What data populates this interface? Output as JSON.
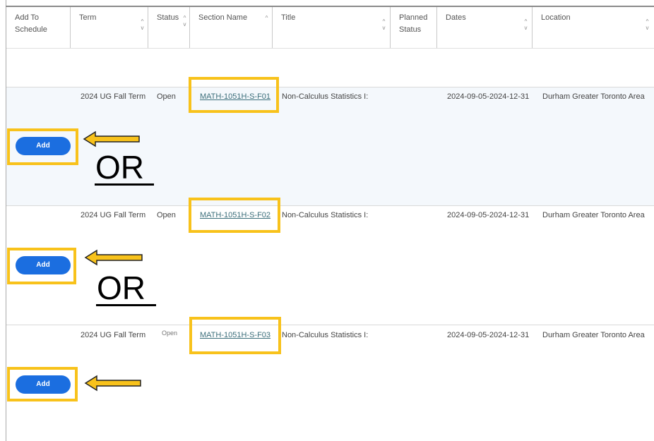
{
  "columns": [
    {
      "label": "Add To Schedule",
      "sortable": false
    },
    {
      "label": "Term",
      "sortable": true
    },
    {
      "label": "Status",
      "sortable": true
    },
    {
      "label": "Section Name",
      "sortable": true
    },
    {
      "label": "Title",
      "sortable": true
    },
    {
      "label": "Planned Status",
      "sortable": true
    },
    {
      "label": "Dates",
      "sortable": true
    },
    {
      "label": "Location",
      "sortable": true
    }
  ],
  "header_lines": {
    "add_to": "Add To",
    "schedule": "Schedule",
    "planned": "Planned",
    "status": "Status"
  },
  "sort_glyphs": {
    "up": "^",
    "down": "v"
  },
  "rows": [
    {
      "term": "2024 UG Fall Term",
      "status": "Open",
      "section": "MATH-1051H-S-F01",
      "title": "Non-Calculus Statistics I:",
      "dates": "2024-09-05-2024-12-31",
      "location": "Durham Greater Toronto Area",
      "add_label": "Add",
      "annotation": "OR"
    },
    {
      "term": "2024 UG Fall Term",
      "status": "Open",
      "section": "MATH-1051H-S-F02",
      "title": "Non-Calculus Statistics I:",
      "dates": "2024-09-05-2024-12-31",
      "location": "Durham Greater Toronto Area",
      "add_label": "Add",
      "annotation": "OR"
    },
    {
      "term": "2024 UG Fall Term",
      "status": "Open",
      "section": "MATH-1051H-S-F03",
      "title": "Non-Calculus Statistics I:",
      "dates": "2024-09-05-2024-12-31",
      "location": "Durham Greater Toronto Area",
      "add_label": "Add",
      "annotation": ""
    }
  ],
  "colors": {
    "highlight": "#f8c21b",
    "button": "#1b6ee0",
    "row_shade": "#f4f8fc",
    "link": "#3b6e7a"
  }
}
